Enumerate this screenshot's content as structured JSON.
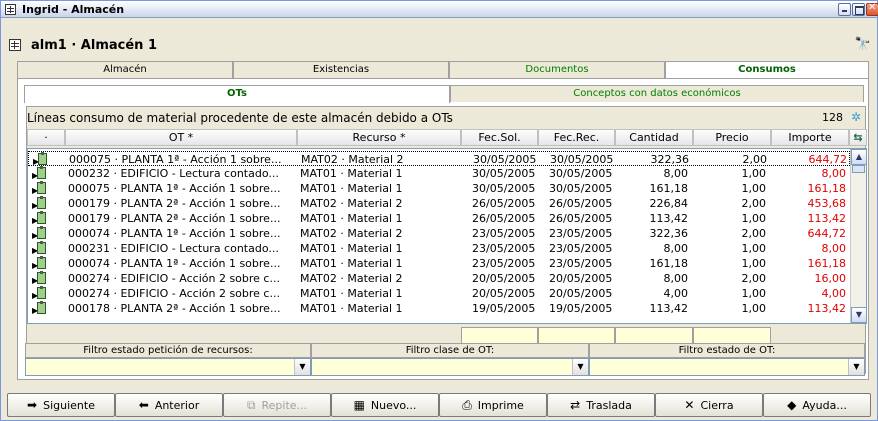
{
  "window": {
    "title": "Ingrid - Almacén"
  },
  "header": {
    "doc_title": "alm1 · Almacén 1"
  },
  "top_tabs": [
    "Almacén",
    "Existencias",
    "Documentos",
    "Consumos"
  ],
  "sub_tabs": [
    "OTs",
    "Conceptos con datos económicos"
  ],
  "content": {
    "description": "Líneas consumo de material procedente de este almacén debido a OTs",
    "count": "128"
  },
  "columns": {
    "c0": "·",
    "ot": "OT *",
    "recurso": "Recurso *",
    "fecsol": "Fec.Sol.",
    "fecrec": "Fec.Rec.",
    "cantidad": "Cantidad",
    "precio": "Precio",
    "importe": "Importe"
  },
  "rows": [
    {
      "ot": "000075 · PLANTA 1ª - Acción 1 sobre...",
      "recurso": "MAT02 · Material 2",
      "fecsol": "30/05/2005",
      "fecrec": "30/05/2005",
      "cantidad": "322,36",
      "precio": "2,00",
      "importe": "644,72"
    },
    {
      "ot": "000232 · EDIFICIO - Lectura contado...",
      "recurso": "MAT01 · Material 1",
      "fecsol": "30/05/2005",
      "fecrec": "30/05/2005",
      "cantidad": "8,00",
      "precio": "1,00",
      "importe": "8,00"
    },
    {
      "ot": "000075 · PLANTA 1ª - Acción 1 sobre...",
      "recurso": "MAT01 · Material 1",
      "fecsol": "30/05/2005",
      "fecrec": "30/05/2005",
      "cantidad": "161,18",
      "precio": "1,00",
      "importe": "161,18"
    },
    {
      "ot": "000179 · PLANTA 2ª - Acción 1 sobre...",
      "recurso": "MAT02 · Material 2",
      "fecsol": "26/05/2005",
      "fecrec": "26/05/2005",
      "cantidad": "226,84",
      "precio": "2,00",
      "importe": "453,68"
    },
    {
      "ot": "000179 · PLANTA 2ª - Acción 1 sobre...",
      "recurso": "MAT01 · Material 1",
      "fecsol": "26/05/2005",
      "fecrec": "26/05/2005",
      "cantidad": "113,42",
      "precio": "1,00",
      "importe": "113,42"
    },
    {
      "ot": "000074 · PLANTA 1ª - Acción 1 sobre...",
      "recurso": "MAT02 · Material 2",
      "fecsol": "23/05/2005",
      "fecrec": "23/05/2005",
      "cantidad": "322,36",
      "precio": "2,00",
      "importe": "644,72"
    },
    {
      "ot": "000231 · EDIFICIO - Lectura contado...",
      "recurso": "MAT01 · Material 1",
      "fecsol": "23/05/2005",
      "fecrec": "23/05/2005",
      "cantidad": "8,00",
      "precio": "1,00",
      "importe": "8,00"
    },
    {
      "ot": "000074 · PLANTA 1ª - Acción 1 sobre...",
      "recurso": "MAT01 · Material 1",
      "fecsol": "23/05/2005",
      "fecrec": "23/05/2005",
      "cantidad": "161,18",
      "precio": "1,00",
      "importe": "161,18"
    },
    {
      "ot": "000274 · EDIFICIO - Acción 2 sobre c...",
      "recurso": "MAT02 · Material 2",
      "fecsol": "20/05/2005",
      "fecrec": "20/05/2005",
      "cantidad": "8,00",
      "precio": "2,00",
      "importe": "16,00"
    },
    {
      "ot": "000274 · EDIFICIO - Acción 2 sobre c...",
      "recurso": "MAT01 · Material 1",
      "fecsol": "20/05/2005",
      "fecrec": "20/05/2005",
      "cantidad": "4,00",
      "precio": "1,00",
      "importe": "4,00"
    },
    {
      "ot": "000178 · PLANTA 2ª - Acción 1 sobre...",
      "recurso": "MAT01 · Material 1",
      "fecsol": "19/05/2005",
      "fecrec": "19/05/2005",
      "cantidad": "113,42",
      "precio": "1,00",
      "importe": "113,42"
    }
  ],
  "filters": {
    "f1_label": "Filtro estado petición de recursos:",
    "f2_label": "Filtro clase de OT:",
    "f3_label": "Filtro estado de OT:"
  },
  "buttons": {
    "siguiente": "Siguiente",
    "anterior": "Anterior",
    "repite": "Repite...",
    "nuevo": "Nuevo...",
    "imprime": "Imprime",
    "traslada": "Traslada",
    "cierra": "Cierra",
    "ayuda": "Ayuda..."
  },
  "colors": {
    "importe_text": "#e00000",
    "active_tab_text": "#006400",
    "totals_bg": "#ffffd8"
  }
}
